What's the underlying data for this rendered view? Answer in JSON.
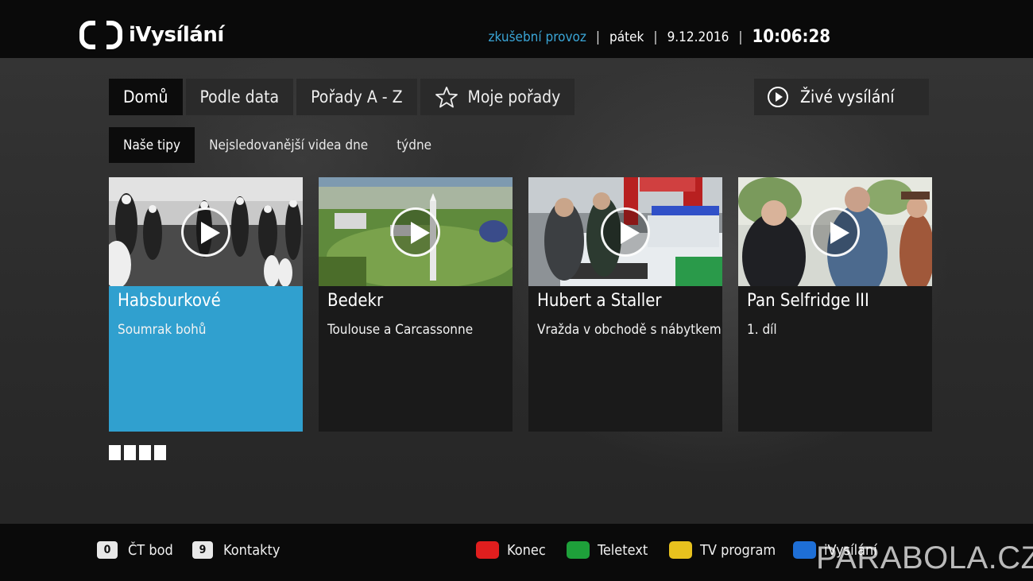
{
  "app": {
    "name": "iVysílání",
    "status_text": "zkušební provoz",
    "day": "pátek",
    "date": "9.12.2016",
    "time": "10:06:28"
  },
  "nav": {
    "tabs": [
      "Domů",
      "Podle data",
      "Pořady A - Z",
      "Moje pořady"
    ],
    "active_tab": "Domů",
    "live_label": "Živé vysílání"
  },
  "subnav": {
    "tabs": [
      "Naše tipy",
      "Nejsledovanější videa dne",
      "týdne"
    ],
    "active_tab": "Naše tipy"
  },
  "cards": [
    {
      "title": "Habsburkové",
      "subtitle": "Soumrak bohů",
      "focused": true
    },
    {
      "title": "Bedekr",
      "subtitle": "Toulouse a Carcassonne",
      "focused": false
    },
    {
      "title": "Hubert a Staller",
      "subtitle": "Vražda v obchodě s nábytkem",
      "focused": false
    },
    {
      "title": "Pan Selfridge III",
      "subtitle": "1. díl",
      "focused": false
    }
  ],
  "pager": {
    "count": 4
  },
  "footer": {
    "left_hints": [
      {
        "key": "0",
        "label": "ČT bod"
      },
      {
        "key": "9",
        "label": "Kontakty"
      }
    ],
    "color_hints": [
      {
        "color": "#e01e1e",
        "label": "Konec"
      },
      {
        "color": "#1ea03a",
        "label": "Teletext"
      },
      {
        "color": "#e8c21e",
        "label": "TV program"
      },
      {
        "color": "#1e6fd6",
        "label": "iVysílání"
      }
    ]
  },
  "watermark": "PARABOLA.CZ",
  "colors": {
    "accent": "#30a0cf",
    "status": "#3aa5d6"
  }
}
